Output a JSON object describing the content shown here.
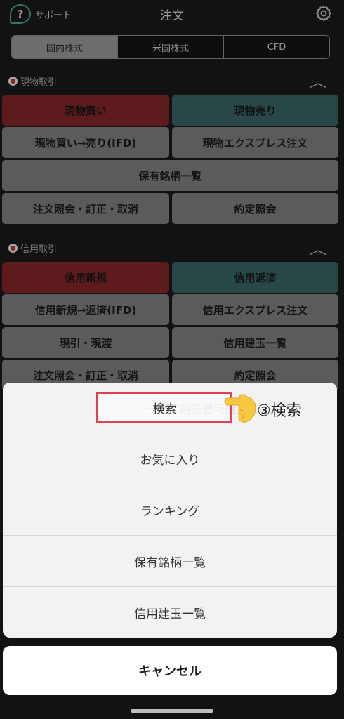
{
  "header": {
    "support_icon": "?",
    "support_label": "サポート",
    "title": "注文",
    "settings_icon": "gear-icon"
  },
  "tabs": [
    {
      "label": "国内株式",
      "active": true
    },
    {
      "label": "米国株式",
      "active": false
    },
    {
      "label": "CFD",
      "active": false
    }
  ],
  "genbutsu": {
    "title": "現物取引",
    "buy": "現物買い",
    "sell": "現物売り",
    "ifd": "現物買い→売り(IFD)",
    "express": "現物エクスプレス注文",
    "holdings": "保有銘柄一覧",
    "inquiry": "注文照会・訂正・取消",
    "executions": "約定照会"
  },
  "shinyo": {
    "title": "信用取引",
    "new": "信用新規",
    "repay": "信用返済",
    "ifd": "信用新規→返済(IFD)",
    "express": "信用エクスプレス注文",
    "genbiki": "現引・現渡",
    "positions": "信用建玉一覧",
    "inquiry": "注文照会・訂正・取消",
    "executions": "約定照会",
    "hidden_partial": "一般信用売建可能"
  },
  "sheet": {
    "items": [
      "検索",
      "お気に入り",
      "ランキング",
      "保有銘柄一覧",
      "信用建玉一覧"
    ],
    "cancel": "キャンセル"
  },
  "annotation": {
    "text": "③検索",
    "highlight_color": "#e0404f"
  },
  "colors": {
    "buy_red": "#8f2a2f",
    "sell_teal": "#3e6d6e",
    "accent_teal": "#4fb3aa"
  }
}
